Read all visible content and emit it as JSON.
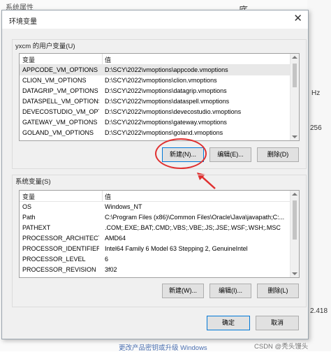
{
  "background": {
    "left_top_text": "系统属性",
    "right_top_char": "底",
    "right_texts": [
      "Hz",
      "256",
      "2.418"
    ],
    "bottom_link": "更改产品密钥或升级 Windows",
    "watermark": "CSDN @秃头馒头"
  },
  "dialog": {
    "title": "环境变量",
    "close_glyph": "✕"
  },
  "user_vars": {
    "label": "yxcm 的用户变量(U)",
    "headers": [
      "变量",
      "值"
    ],
    "rows": [
      [
        "APPCODE_VM_OPTIONS",
        "D:\\SCY\\2022\\vmoptions\\appcode.vmoptions"
      ],
      [
        "CLION_VM_OPTIONS",
        "D:\\SCY\\2022\\vmoptions\\clion.vmoptions"
      ],
      [
        "DATAGRIP_VM_OPTIONS",
        "D:\\SCY\\2022\\vmoptions\\datagrip.vmoptions"
      ],
      [
        "DATASPELL_VM_OPTIONS",
        "D:\\SCY\\2022\\vmoptions\\dataspell.vmoptions"
      ],
      [
        "DEVECOSTUDIO_VM_OPT...",
        "D:\\SCY\\2022\\vmoptions\\devecostudio.vmoptions"
      ],
      [
        "GATEWAY_VM_OPTIONS",
        "D:\\SCY\\2022\\vmoptions\\gateway.vmoptions"
      ],
      [
        "GOLAND_VM_OPTIONS",
        "D:\\SCY\\2022\\vmoptions\\goland.vmoptions"
      ]
    ],
    "buttons": {
      "new": "新建(N)...",
      "edit": "编辑(E)...",
      "delete": "删除(D)"
    }
  },
  "system_vars": {
    "label": "系统变量(S)",
    "headers": [
      "变量",
      "值"
    ],
    "rows": [
      [
        "OS",
        "Windows_NT"
      ],
      [
        "Path",
        "C:\\Program Files (x86)\\Common Files\\Oracle\\Java\\javapath;C:..."
      ],
      [
        "PATHEXT",
        ".COM;.EXE;.BAT;.CMD;.VBS;.VBE;.JS;.JSE;.WSF;.WSH;.MSC"
      ],
      [
        "PROCESSOR_ARCHITECT...",
        "AMD64"
      ],
      [
        "PROCESSOR_IDENTIFIER",
        "Intel64 Family 6 Model 63 Stepping 2, GenuineIntel"
      ],
      [
        "PROCESSOR_LEVEL",
        "6"
      ],
      [
        "PROCESSOR_REVISION",
        "3f02"
      ]
    ],
    "buttons": {
      "new": "新建(W)...",
      "edit": "编辑(I)...",
      "delete": "删除(L)"
    }
  },
  "footer": {
    "ok": "确定",
    "cancel": "取消"
  },
  "colors": {
    "annotation": "#e03030",
    "selection": "#e8e8e8",
    "default_button_border": "#0078d7"
  }
}
